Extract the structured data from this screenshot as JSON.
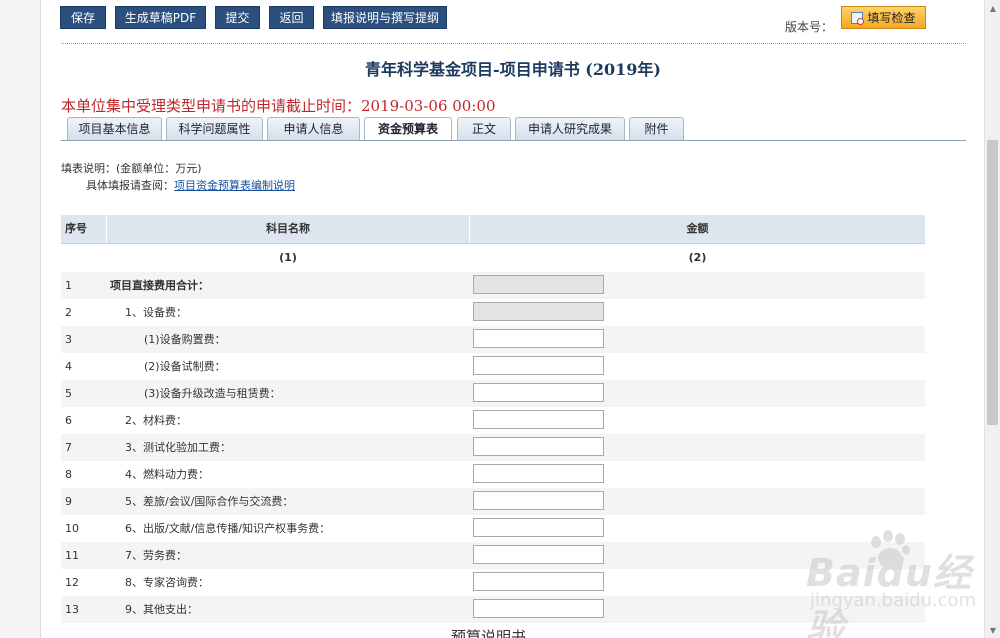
{
  "toolbar": {
    "save": "保存",
    "pdf": "生成草稿PDF",
    "submit": "提交",
    "back": "返回",
    "guide": "填报说明与撰写提纲",
    "version_label": "版本号：",
    "check": "填写检查"
  },
  "title": "青年科学基金项目-项目申请书 (2019年)",
  "deadline": "本单位集中受理类型申请书的申请截止时间：2019-03-06 00:00",
  "tabs": [
    {
      "label": "项目基本信息"
    },
    {
      "label": "科学问题属性"
    },
    {
      "label": "申请人信息"
    },
    {
      "label": "资金预算表",
      "active": true
    },
    {
      "label": "正文"
    },
    {
      "label": "申请人研究成果"
    },
    {
      "label": "附件"
    }
  ],
  "notes": {
    "line1": "填表说明：(金额单位：万元)",
    "line2_prefix": "具体填报请查阅：",
    "line2_link": "项目资金预算表编制说明"
  },
  "table": {
    "headers": {
      "seq": "序号",
      "name": "科目名称",
      "amount": "金额"
    },
    "subheaders": {
      "name": "(1)",
      "amount": "(2)"
    },
    "rows": [
      {
        "seq": "1",
        "name": "项目直接费用合计：",
        "readonly": true,
        "bold": true,
        "indent": 0
      },
      {
        "seq": "2",
        "name": "1、设备费：",
        "readonly": true,
        "indent": 1
      },
      {
        "seq": "3",
        "name": "(1)设备购置费：",
        "readonly": false,
        "indent": 2
      },
      {
        "seq": "4",
        "name": "(2)设备试制费：",
        "readonly": false,
        "indent": 2
      },
      {
        "seq": "5",
        "name": "(3)设备升级改造与租赁费：",
        "readonly": false,
        "indent": 2
      },
      {
        "seq": "6",
        "name": "2、材料费：",
        "readonly": false,
        "indent": 1
      },
      {
        "seq": "7",
        "name": "3、测试化验加工费：",
        "readonly": false,
        "indent": 1
      },
      {
        "seq": "8",
        "name": "4、燃料动力费：",
        "readonly": false,
        "indent": 1
      },
      {
        "seq": "9",
        "name": "5、差旅/会议/国际合作与交流费：",
        "readonly": false,
        "indent": 1
      },
      {
        "seq": "10",
        "name": "6、出版/文献/信息传播/知识产权事务费：",
        "readonly": false,
        "indent": 1
      },
      {
        "seq": "11",
        "name": "7、劳务费：",
        "readonly": false,
        "indent": 1
      },
      {
        "seq": "12",
        "name": "8、专家咨询费：",
        "readonly": false,
        "indent": 1
      },
      {
        "seq": "13",
        "name": "9、其他支出：",
        "readonly": false,
        "indent": 1
      }
    ]
  },
  "footer_partial": "预算说明书",
  "watermark": {
    "logo": "Baidu经验",
    "url": "jingyan.baidu.com"
  }
}
